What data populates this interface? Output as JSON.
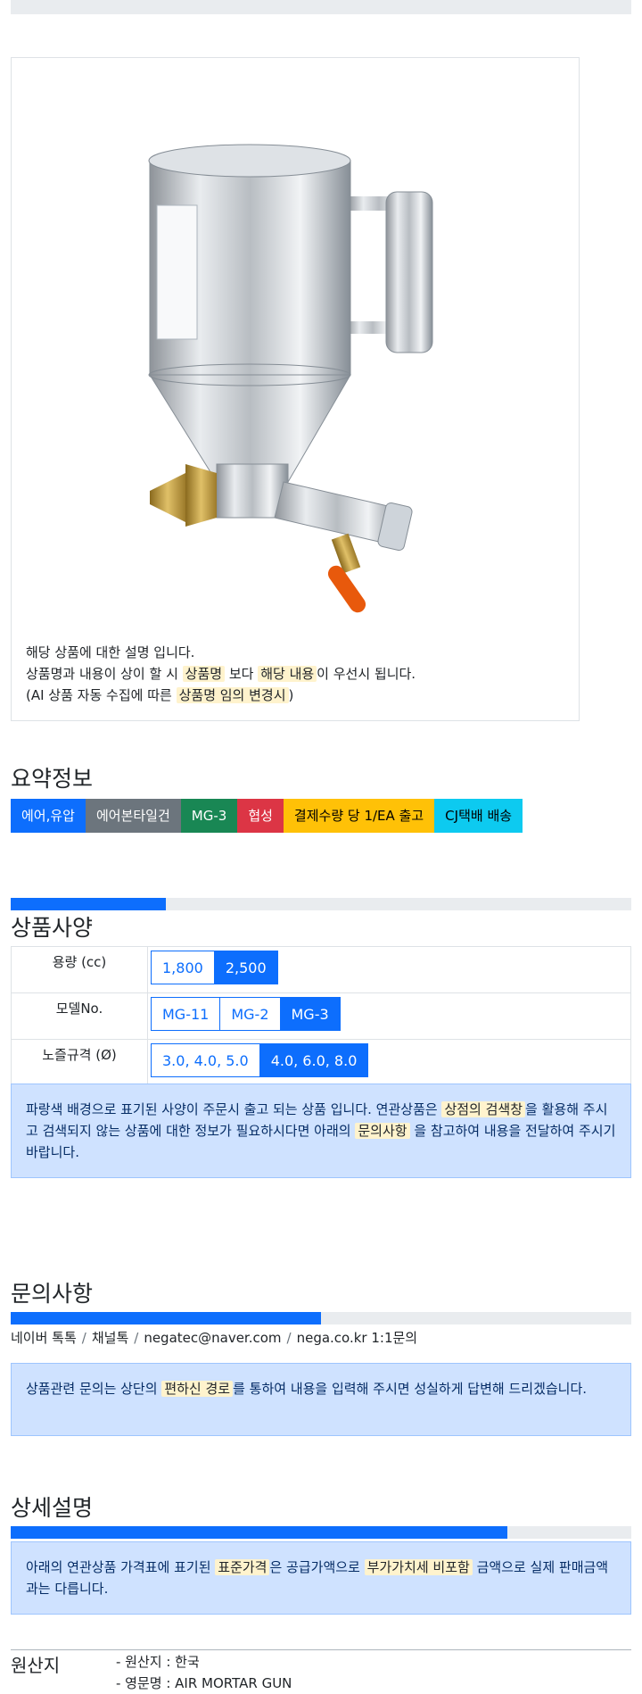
{
  "product": {
    "image_alt": "에어본타일건 MG-3",
    "description": {
      "line1": "해당 상품에 대한 설명 입니다.",
      "line2_a": "상품명과 내용이 상이 할 시 ",
      "line2_hl1": "상품명",
      "line2_b": " 보다 ",
      "line2_hl2": "해당 내용",
      "line2_c": "이 우선시 됩니다.",
      "line3_a": "(AI 상품 자동 수집에 따른 ",
      "line3_hl": "상품명 임의 변경시",
      "line3_b": ")"
    }
  },
  "summary": {
    "title": "요약정보",
    "badges": [
      "에어,유압",
      "에어본타일건",
      "MG-3",
      "협성",
      "결제수량 당 1/EA 출고",
      "CJ택배 배송"
    ]
  },
  "spec": {
    "title": "상품사양",
    "progress": 0.25,
    "rows": [
      {
        "label": "용량 (cc)",
        "options": [
          "1,800",
          "2,500"
        ],
        "selected": 1
      },
      {
        "label": "모델No.",
        "options": [
          "MG-11",
          "MG-2",
          "MG-3"
        ],
        "selected": 2
      },
      {
        "label": "노즐규격 (Ø)",
        "options": [
          "3.0, 4.0, 5.0",
          "4.0, 6.0, 8.0"
        ],
        "selected": 1
      }
    ],
    "notice": {
      "a": "파랑색 배경으로 표기된 사양이 주문시 출고 되는 상품 입니다. 연관상품은 ",
      "hl1": "상점의 검색창",
      "b": "을 활용해 주시고 검색되지 않는 상품에 대한 정보가 필요하시다면 아래의 ",
      "hl2": "문의사항",
      "c": " 을 참고하여 내용을 전달하여 주시기 바랍니다."
    }
  },
  "inquiry": {
    "title": "문의사항",
    "progress": 0.5,
    "contacts": [
      "네이버 톡톡",
      "채널톡",
      "negatec@naver.com",
      "nega.co.kr 1:1문의"
    ],
    "notice": {
      "a": "상품관련 문의는 상단의 ",
      "hl": "편하신 경로",
      "b": "를 통하여 내용을 입력해 주시면 성실하게 답변해 드리겠습니다."
    }
  },
  "detail": {
    "title": "상세설명",
    "progress": 0.8,
    "notice": {
      "a": "아래의 연관상품 가격표에 표기된 ",
      "hl1": "표준가격",
      "b": "은 공급가액으로 ",
      "hl2": "부가가치세 비포함",
      "c": " 금액으로 실제 판매금액과는 다릅니다."
    }
  },
  "origin": {
    "title": "원산지",
    "items": [
      "- 원산지 : 한국",
      "- 영문명 : AIR MORTAR GUN"
    ]
  },
  "colors": {
    "primary": "#0d6efd",
    "alert_bg": "#cfe2ff",
    "highlight": "#fff3cd"
  }
}
